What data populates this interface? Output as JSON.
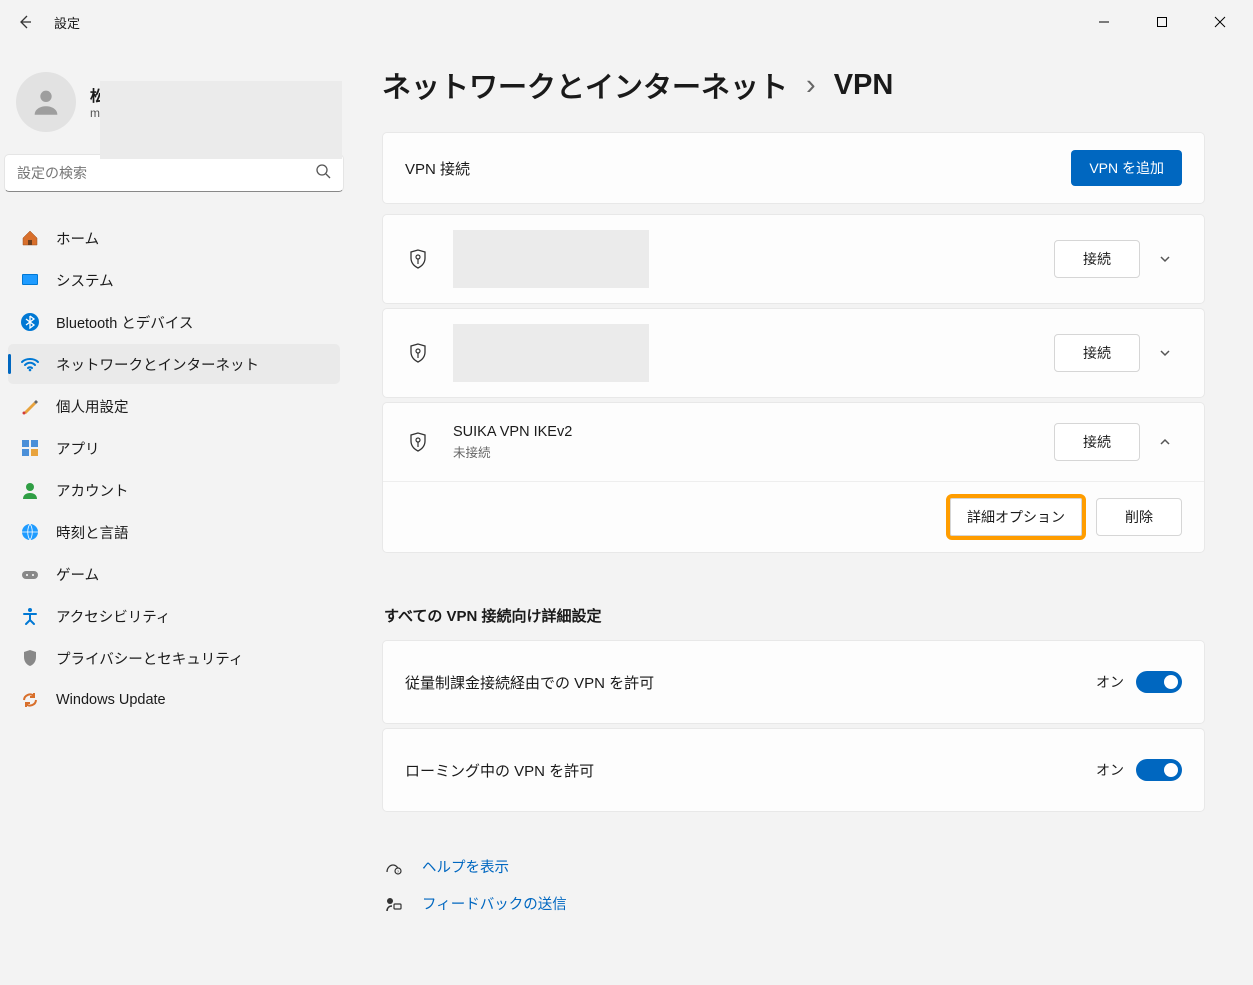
{
  "app_title": "設定",
  "user": {
    "name": "松",
    "email": "m"
  },
  "search": {
    "placeholder": "設定の検索"
  },
  "sidebar": {
    "items": [
      {
        "id": "home",
        "label": "ホーム"
      },
      {
        "id": "system",
        "label": "システム"
      },
      {
        "id": "bluetooth",
        "label": "Bluetooth とデバイス"
      },
      {
        "id": "network",
        "label": "ネットワークとインターネット",
        "active": true
      },
      {
        "id": "personalization",
        "label": "個人用設定"
      },
      {
        "id": "apps",
        "label": "アプリ"
      },
      {
        "id": "accounts",
        "label": "アカウント"
      },
      {
        "id": "time",
        "label": "時刻と言語"
      },
      {
        "id": "gaming",
        "label": "ゲーム"
      },
      {
        "id": "accessibility",
        "label": "アクセシビリティ"
      },
      {
        "id": "privacy",
        "label": "プライバシーとセキュリティ"
      },
      {
        "id": "update",
        "label": "Windows Update"
      }
    ]
  },
  "breadcrumb": {
    "parent": "ネットワークとインターネット",
    "current": "VPN"
  },
  "vpn": {
    "header": "VPN 接続",
    "add_label": "VPN を追加",
    "connect_label": "接続",
    "items": [
      {
        "name": "",
        "status": "",
        "expanded": false,
        "redacted": true
      },
      {
        "name": "",
        "status": "",
        "expanded": false,
        "redacted": true
      },
      {
        "name": "SUIKA VPN IKEv2",
        "status": "未接続",
        "expanded": true,
        "redacted": false
      }
    ],
    "advanced_label": "詳細オプション",
    "delete_label": "削除"
  },
  "advanced_heading": "すべての VPN 接続向け詳細設定",
  "settings": {
    "metered": {
      "label": "従量制課金接続経由での VPN を許可",
      "state": "オン",
      "on": true
    },
    "roaming": {
      "label": "ローミング中の VPN を許可",
      "state": "オン",
      "on": true
    }
  },
  "footer": {
    "help": "ヘルプを表示",
    "feedback": "フィードバックの送信"
  }
}
